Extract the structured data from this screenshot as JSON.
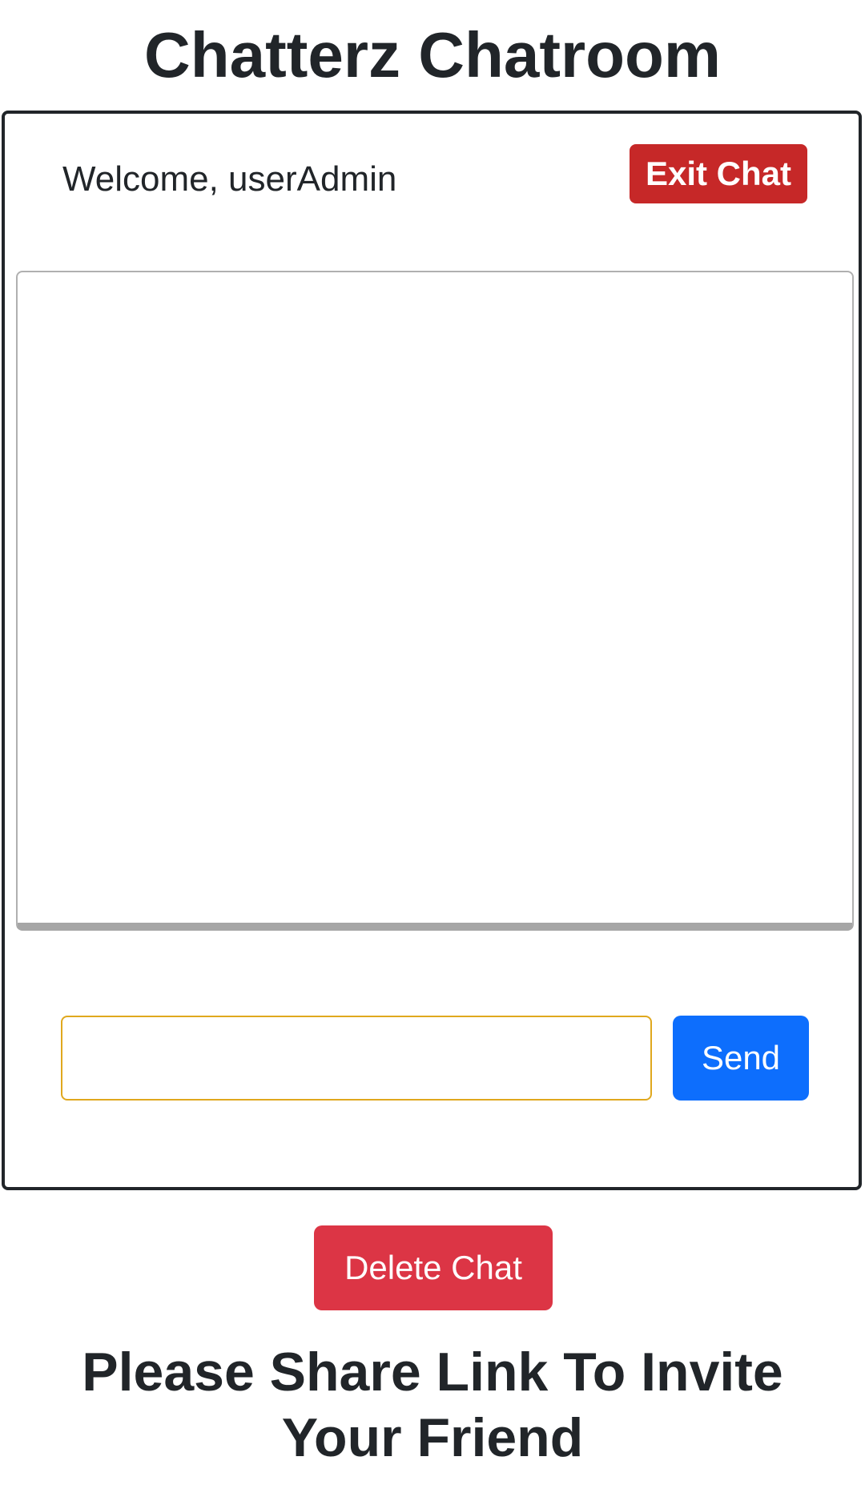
{
  "page": {
    "title": "Chatterz Chatroom",
    "invite_heading": "Please Share Link To Invite Your Friend"
  },
  "chat": {
    "welcome_prefix": "Welcome, ",
    "username": "userAdmin",
    "exit_label": "Exit Chat",
    "messages": [],
    "input_value": "",
    "send_label": "Send"
  },
  "actions": {
    "delete_label": "Delete Chat"
  },
  "colors": {
    "exit_button": "#c62828",
    "send_button": "#0d6efd",
    "delete_button": "#dc3545",
    "input_border": "#e0a81e",
    "text": "#212529"
  }
}
